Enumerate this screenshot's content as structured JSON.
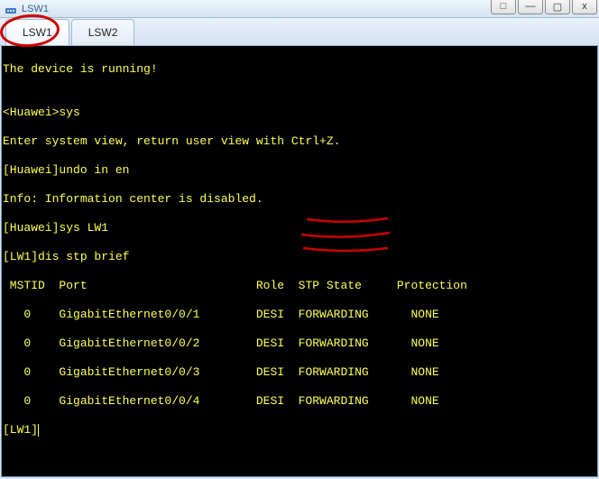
{
  "window": {
    "title": "LSW1",
    "buttons": {
      "extra": "□",
      "minimize": "—",
      "maximize": "▢",
      "close": "x"
    }
  },
  "tabs": [
    {
      "label": "LSW1",
      "active": true
    },
    {
      "label": "LSW2",
      "active": false
    }
  ],
  "terminal": {
    "lines": [
      "The device is running!",
      "",
      "<Huawei>sys",
      "Enter system view, return user view with Ctrl+Z.",
      "[Huawei]undo in en",
      "Info: Information center is disabled.",
      "[Huawei]sys LW1",
      "[LW1]dis stp brief",
      " MSTID  Port                        Role  STP State     Protection",
      "   0    GigabitEthernet0/0/1        DESI  FORWARDING      NONE",
      "   0    GigabitEthernet0/0/2        DESI  FORWARDING      NONE",
      "   0    GigabitEthernet0/0/3        DESI  FORWARDING      NONE",
      "   0    GigabitEthernet0/0/4        DESI  FORWARDING      NONE",
      "[LW1]"
    ]
  },
  "chart_data": {
    "type": "table",
    "title": "STP brief",
    "columns": [
      "MSTID",
      "Port",
      "Role",
      "STP State",
      "Protection"
    ],
    "rows": [
      [
        0,
        "GigabitEthernet0/0/1",
        "DESI",
        "FORWARDING",
        "NONE"
      ],
      [
        0,
        "GigabitEthernet0/0/2",
        "DESI",
        "FORWARDING",
        "NONE"
      ],
      [
        0,
        "GigabitEthernet0/0/3",
        "DESI",
        "FORWARDING",
        "NONE"
      ],
      [
        0,
        "GigabitEthernet0/0/4",
        "DESI",
        "FORWARDING",
        "NONE"
      ]
    ]
  },
  "annotations": {
    "highlighted_rows": [
      1,
      2,
      3
    ],
    "circled_tab": "LSW1"
  }
}
